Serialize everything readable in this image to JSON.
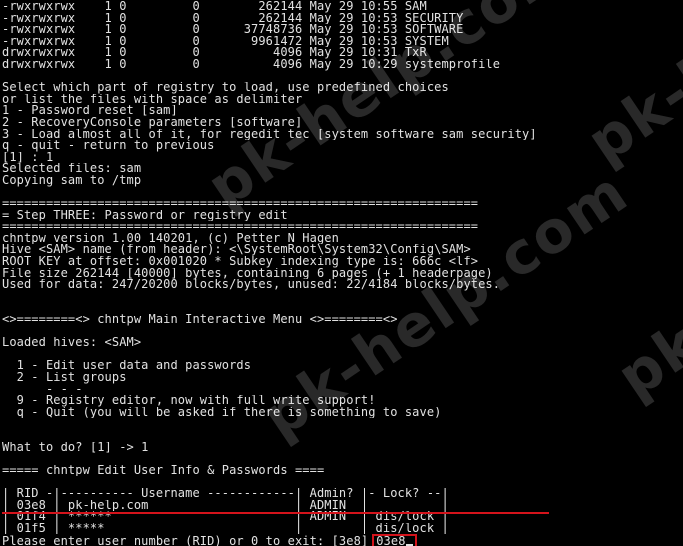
{
  "terminal": {
    "lines": [
      "-rwxrwxrwx    1 0         0        262144 May 29 10:55 SAM",
      "-rwxrwxrwx    1 0         0        262144 May 29 10:53 SECURITY",
      "-rwxrwxrwx    1 0         0      37748736 May 29 10:53 SOFTWARE",
      "-rwxrwxrwx    1 0         0       9961472 May 29 10:53 SYSTEM",
      "drwxrwxrwx    1 0         0          4096 May 29 10:31 TxR",
      "drwxrwxrwx    1 0         0          4096 May 29 10:29 systemprofile",
      "",
      "Select which part of registry to load, use predefined choices",
      "or list the files with space as delimiter",
      "1 - Password reset [sam]",
      "2 - RecoveryConsole parameters [software]",
      "3 - Load almost all of it, for regedit tec [system software sam security]",
      "q - quit - return to previous",
      "[1] : 1",
      "Selected files: sam",
      "Copying sam to /tmp",
      "",
      "=================================================================",
      "= Step THREE: Password or registry edit",
      "=================================================================",
      "chntpw version 1.00 140201, (c) Petter N Hagen",
      "Hive <SAM> name (from header): <\\SystemRoot\\System32\\Config\\SAM>",
      "ROOT KEY at offset: 0x001020 * Subkey indexing type is: 666c <lf>",
      "File size 262144 [40000] bytes, containing 6 pages (+ 1 headerpage)",
      "Used for data: 247/20200 blocks/bytes, unused: 22/4184 blocks/bytes.",
      "",
      "",
      "<>========<> chntpw Main Interactive Menu <>========<>",
      "",
      "Loaded hives: <SAM>",
      "",
      "  1 - Edit user data and passwords",
      "  2 - List groups",
      "      - - -",
      "  9 - Registry editor, now with full write support!",
      "  q - Quit (you will be asked if there is something to save)",
      "",
      "",
      "What to do? [1] -> 1",
      "",
      "===== chntpw Edit User Info & Passwords ====",
      "",
      "| RID -|---------- Username ------------| Admin? |- Lock? --|",
      "| 03e8 | pk-help.com                    | ADMIN  |          |",
      "| 01f4 | ******                         | ADMIN  | dis/lock |",
      "| 01f5 | *****                          |        | dis/lock |"
    ],
    "prompt": "Please enter user number (RID) or 0 to exit: [3e8]",
    "input_value": "03e8"
  },
  "watermarks": [
    "pk-help.com",
    "pk-help.com",
    "pk-help.com",
    "pk-help.com"
  ],
  "colors": {
    "background": "#000000",
    "text": "#e2e2e2",
    "highlight": "#d4131b"
  }
}
